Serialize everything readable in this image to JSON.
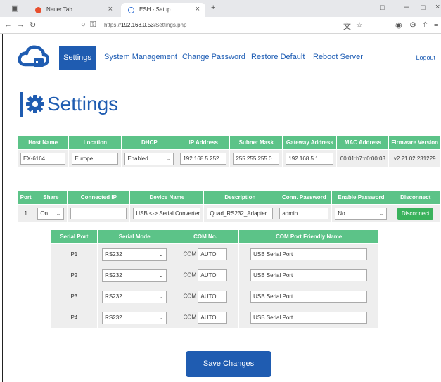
{
  "browser": {
    "tabs": [
      {
        "label": "Neuer Tab"
      },
      {
        "label": "ESH - Setup"
      }
    ],
    "url_prefix": "https://",
    "url_host": "192.168.0.53",
    "url_path": "/Settings.php"
  },
  "nav": {
    "items": [
      "Settings",
      "System Management",
      "Change Password",
      "Restore Default",
      "Reboot Server"
    ],
    "logout": "Logout"
  },
  "page_title": "Settings",
  "server_table": {
    "headers": [
      "Host Name",
      "Location",
      "DHCP",
      "IP Address",
      "Subnet Mask",
      "Gateway Address",
      "MAC Address",
      "Firmware Version"
    ],
    "host_name": "EX-6164",
    "location": "Europe",
    "dhcp": "Enabled",
    "ip_address": "192.168.5.252",
    "subnet_mask": "255.255.255.0",
    "gateway_address": "192.168.5.1",
    "mac_address": "00:01:b7:c0:00:03",
    "firmware_version": "v2.21.02.231229"
  },
  "port_table": {
    "headers": [
      "Port",
      "Share",
      "Connected IP",
      "Device Name",
      "Description",
      "Conn. Password",
      "Enable Password",
      "Disconnect"
    ],
    "port": "1",
    "share": "On",
    "connected_ip": "",
    "device_name": "USB <-> Serial Converter",
    "description": "Quad_RS232_Adapter",
    "conn_password": "admin",
    "enable_password": "No",
    "disconnect_label": "Disconnect"
  },
  "serial_table": {
    "headers": [
      "Serial Port",
      "Serial Mode",
      "COM No.",
      "COM Port Friendly Name"
    ],
    "com_prefix": "COM",
    "rows": [
      {
        "port": "P1",
        "mode": "RS232",
        "com": "AUTO",
        "friendly": "USB Serial Port"
      },
      {
        "port": "P2",
        "mode": "RS232",
        "com": "AUTO",
        "friendly": "USB Serial Port"
      },
      {
        "port": "P3",
        "mode": "RS232",
        "com": "AUTO",
        "friendly": "USB Serial Port"
      },
      {
        "port": "P4",
        "mode": "RS232",
        "com": "AUTO",
        "friendly": "USB Serial Port"
      }
    ]
  },
  "save_label": "Save Changes",
  "colors": {
    "accent": "#1f5cb1",
    "table_header": "#5cc388",
    "disconnect": "#3ab25c"
  }
}
